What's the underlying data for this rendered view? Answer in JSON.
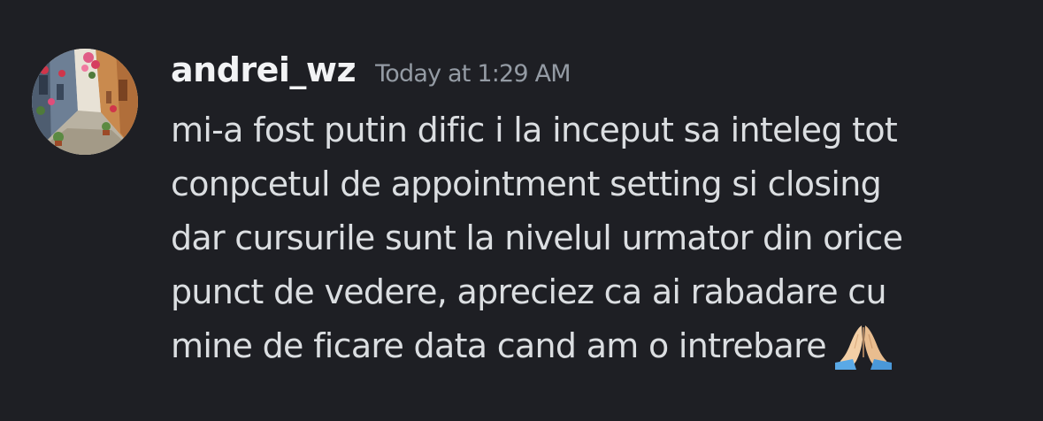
{
  "message": {
    "author": {
      "username": "andrei_wz",
      "avatar_icon": "user-avatar-street-photo"
    },
    "timestamp": "Today at 1:29 AM",
    "content_lines": [
      "mi-a fost putin dific i la inceput sa inteleg tot",
      "conpcetul de appointment setting si closing",
      "dar cursurile sunt la nivelul urmator din orice",
      "punct de vedere, apreciez ca ai rabadare cu",
      "mine de ficare data cand am o intrebare"
    ],
    "emoji": "folded-hands-emoji"
  },
  "colors": {
    "background": "#1e1f24",
    "username": "#f2f3f5",
    "timestamp": "#949ba4",
    "text": "#dbdee1"
  }
}
